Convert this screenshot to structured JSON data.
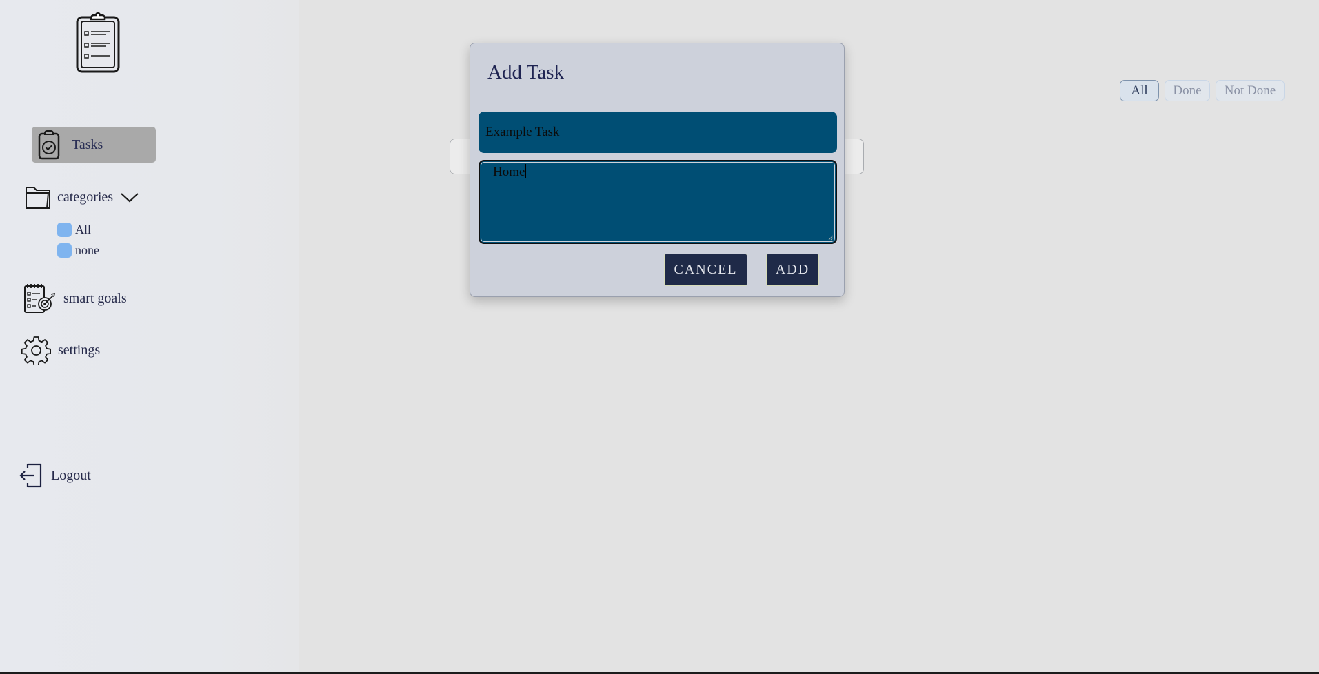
{
  "sidebar": {
    "nav": {
      "tasks_label": "Tasks",
      "categories_label": "categories",
      "smart_goals_label": "smart goals",
      "settings_label": "settings",
      "logout_label": "Logout"
    },
    "categories": [
      {
        "label": "All",
        "color": "#7fb4ef"
      },
      {
        "label": "none",
        "color": "#7fb4ef"
      }
    ],
    "icons": {
      "logo": "clipboard-list-icon",
      "tasks": "clipboard-check-icon",
      "categories": "folder-icon",
      "categories_toggle": "chevron-down-icon",
      "smart_goals": "checklist-target-icon",
      "settings": "gear-icon",
      "logout": "logout-icon"
    }
  },
  "filters": {
    "all": "All",
    "done": "Done",
    "not_done": "Not Done",
    "active": "All"
  },
  "modal": {
    "title": "Add Task",
    "task_name_value": "Example Task",
    "category_value": "Home",
    "cancel_label": "CANCEL",
    "add_label": "ADD"
  },
  "colors": {
    "input_background": "#004e74",
    "button_background": "#1f2a48",
    "active_nav_background": "#a9a9a9",
    "category_dot": "#7fb4ef"
  }
}
